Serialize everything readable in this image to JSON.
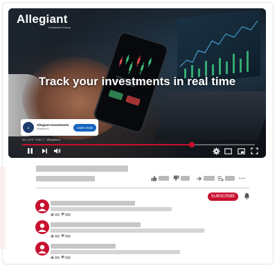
{
  "video": {
    "brand_name": "Allegiant",
    "brand_tagline": "Investment Group",
    "headline": "Track your investments in real time",
    "ad": {
      "title": "Allegiant Investments",
      "domain": "Allegiant.io",
      "cta_label": "Learn more",
      "meta": "Ad 1 of 2 · 0:30 ⓘ · Allegiant.io"
    },
    "progress": 0.73
  },
  "channel": {
    "subscribe_label": "SUBSCRIBE"
  },
  "colors": {
    "accent": "#c8102e",
    "player_bg": "#0f1419",
    "placeholder": "#c7c7c7"
  },
  "icons": {
    "controls": [
      "play-pause-icon",
      "next-icon",
      "volume-icon",
      "settings-icon",
      "subtitles-icon",
      "miniplayer-icon",
      "fullscreen-icon"
    ],
    "actions": [
      "like-icon",
      "dislike-icon",
      "share-icon",
      "save-icon",
      "more-icon"
    ],
    "comments": [
      "user-avatar-icon",
      "comment-like-icon",
      "comment-dislike-icon"
    ]
  }
}
